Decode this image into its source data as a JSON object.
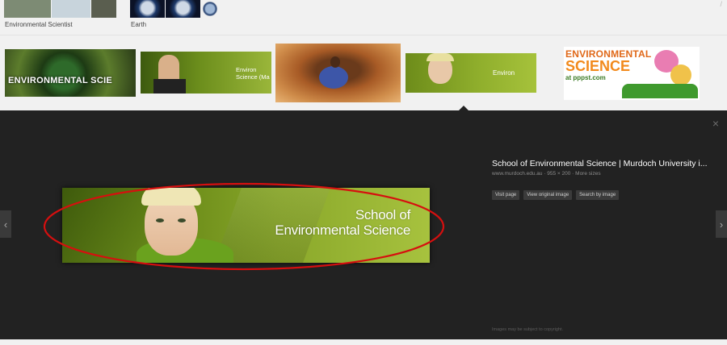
{
  "related_searches": [
    {
      "label": "Environmental Scientist",
      "thumb_colors": [
        "#7d8b74",
        "#c8d4dc",
        "#5a5e4f"
      ]
    },
    {
      "label": "Earth",
      "thumb_colors": [
        "#14254a",
        "#10213f",
        "#0f1c33"
      ]
    }
  ],
  "results": [
    {
      "text": "ENVIRONMENTAL SCIE",
      "colors": [
        "#2f4a18",
        "#6c8a33"
      ]
    },
    {
      "text": "Environ Science (Ma",
      "colors": [
        "#3d5a0e",
        "#8fae2c"
      ]
    },
    {
      "text": "",
      "colors": [
        "#7a3a17",
        "#c77a3b"
      ]
    },
    {
      "text": "Environ",
      "colors": [
        "#6d8c1a",
        "#a6c23b"
      ]
    },
    {
      "text_line1": "ENVIRONMENTAL",
      "text_line2": "SCIENCE",
      "text_line3": "at pppst.com",
      "colors": [
        "#ffffff",
        "#ffffff"
      ]
    }
  ],
  "preview": {
    "banner_line1": "School of",
    "banner_line2": "Environmental Science",
    "title": "School of Environmental Science | Murdoch University i...",
    "meta": "www.murdoch.edu.au · 955 × 200 · More sizes",
    "buttons": [
      "Visit page",
      "View original image",
      "Search by image"
    ],
    "copyright": "Images may be subject to copyright.",
    "close_icon": "×",
    "prev_icon": "‹",
    "next_icon": "›"
  },
  "colors": {
    "panel_bg": "#222222",
    "highlight_ellipse": "#d60f0f",
    "banner_green": "#8aa82a"
  }
}
